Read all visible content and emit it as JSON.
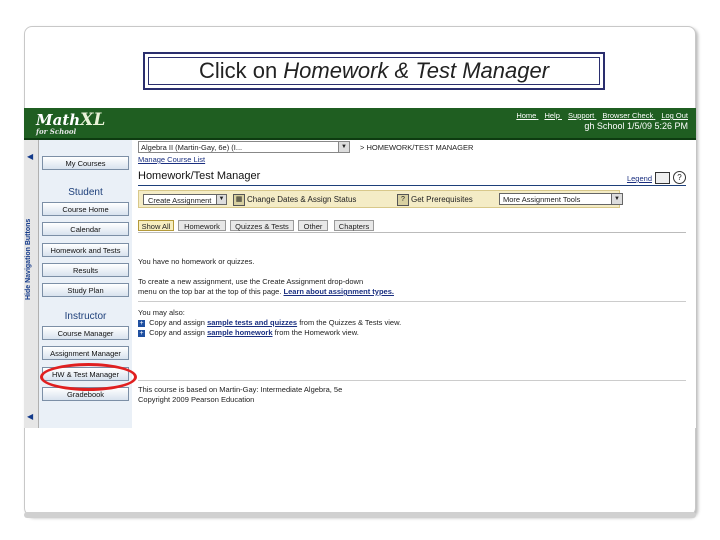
{
  "callout": {
    "prefix": "Click on ",
    "emphasis": "Homework & Test Manager"
  },
  "app": {
    "logo_math": "Math",
    "logo_xl": "XL",
    "logo_sub": "for School",
    "top_links": [
      "Home",
      "Help",
      "Support",
      "Browser Check",
      "Log Out"
    ],
    "school_line": "gh School 1/5/09 5:26 PM",
    "hide_nav_label": "Hide Navigation Buttons"
  },
  "nav": {
    "my_courses": "My Courses",
    "student_heading": "Student",
    "student_items": [
      "Course Home",
      "Calendar",
      "Homework and Tests",
      "Results",
      "Study Plan"
    ],
    "instructor_heading": "Instructor",
    "instructor_items": [
      "Course Manager",
      "Assignment Manager",
      "HW & Test Manager",
      "Gradebook"
    ]
  },
  "content": {
    "course_select": "Algebra II (Martin-Gay, 6e) (I...",
    "breadcrumb": "> HOMEWORK/TEST MANAGER",
    "manage_link": "Manage Course List",
    "page_title": "Homework/Test Manager",
    "legend_link": "Legend",
    "toolbar": {
      "create": "Create Assignment",
      "change_dates": "Change Dates & Assign Status",
      "prereqs": "Get Prerequisites",
      "more_tools": "More Assignment Tools"
    },
    "tabs": [
      "Show All",
      "Homework",
      "Quizzes & Tests",
      "Other",
      "Chapters"
    ],
    "no_assignments": "You have no homework or quizzes.",
    "create_line1": "To create a new assignment, use the Create Assignment drop-down",
    "create_line2_prefix": "menu on the top bar at the top of this page.",
    "learn_link": "Learn about assignment types.",
    "may_also": "You may also:",
    "opt1_prefix": "Copy and assign",
    "opt1_link": "sample tests and quizzes",
    "opt1_suffix": "from the Quizzes & Tests view.",
    "opt2_prefix": "Copy and assign",
    "opt2_link": "sample homework",
    "opt2_suffix": "from the Homework view.",
    "based_on": "This course is based on Martin-Gay: Intermediate Algebra, 5e",
    "copyright": "Copyright 2009 Pearson Education"
  },
  "colors": {
    "topbar": "#1f5e21",
    "highlight_circle": "#e02020",
    "nav_heading": "#1d3f7a",
    "toolbar_bg": "#f4ecc6"
  }
}
